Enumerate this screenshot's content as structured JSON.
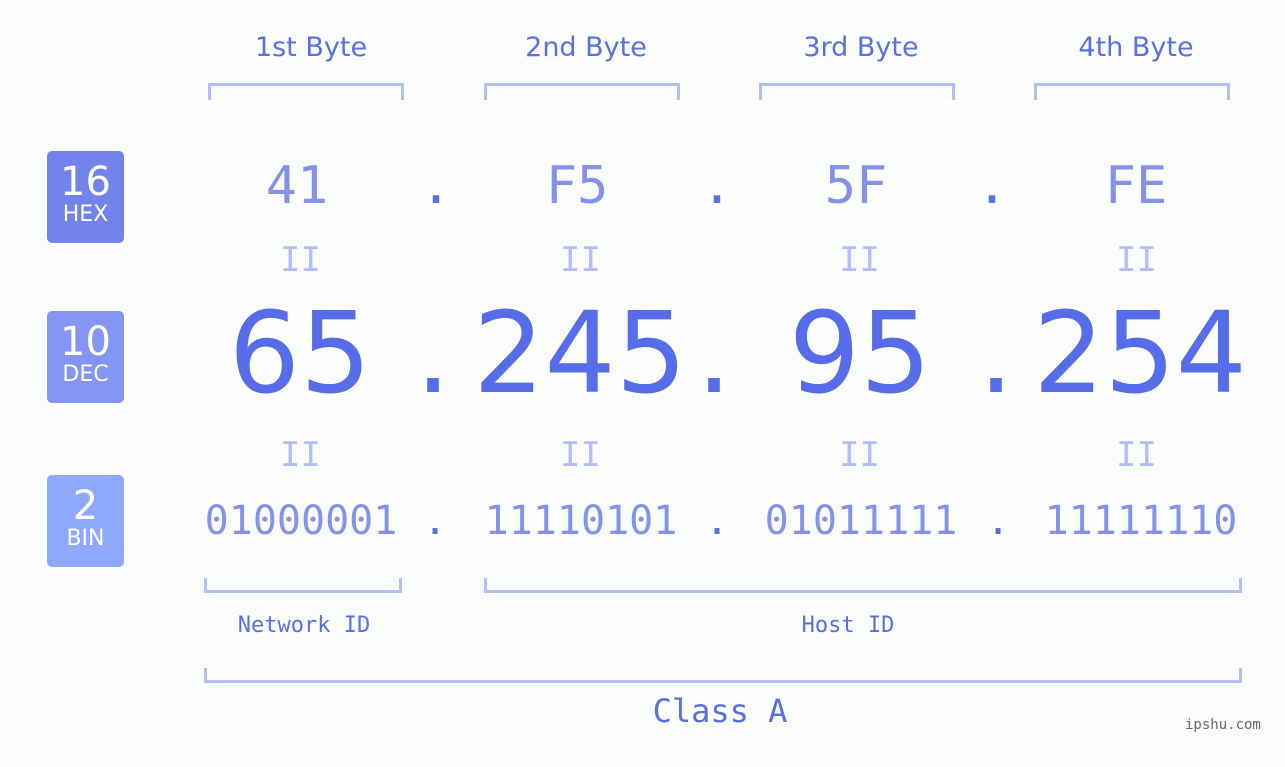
{
  "bytes": [
    {
      "label": "1st Byte",
      "hex": "41",
      "dec": "65",
      "bin": "01000001"
    },
    {
      "label": "2nd Byte",
      "hex": "F5",
      "dec": "245",
      "bin": "11110101"
    },
    {
      "label": "3rd Byte",
      "hex": "5F",
      "dec": "95",
      "bin": "01011111"
    },
    {
      "label": "4th Byte",
      "hex": "FE",
      "dec": "254",
      "bin": "11111110"
    }
  ],
  "badges": {
    "hex": {
      "num": "16",
      "label": "HEX",
      "color": "#7383ec"
    },
    "dec": {
      "num": "10",
      "label": "DEC",
      "color": "#8595f3"
    },
    "bin": {
      "num": "2",
      "label": "BIN",
      "color": "#8ea8fb"
    }
  },
  "separator": ".",
  "equals": "II",
  "network_label": "Network ID",
  "host_label": "Host ID",
  "class_label": "Class A",
  "watermark": "ipshu.com"
}
